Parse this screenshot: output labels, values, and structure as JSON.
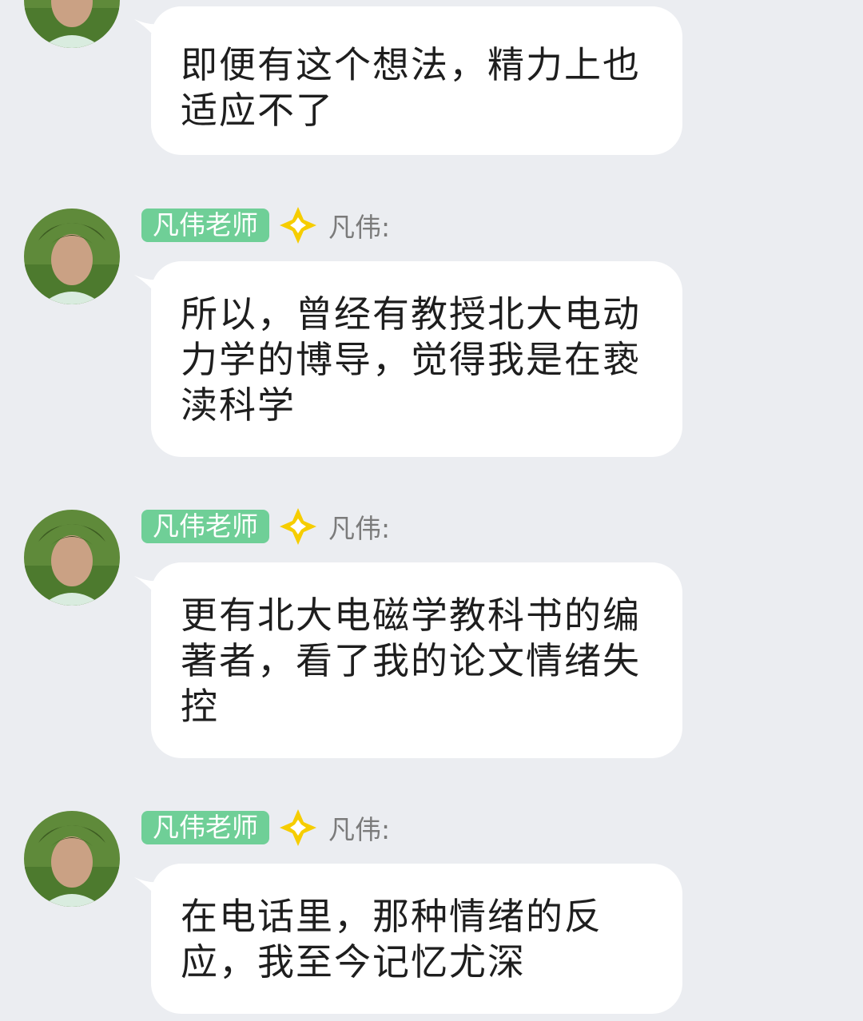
{
  "colors": {
    "background": "#ebedf1",
    "bubble": "#ffffff",
    "badge": "#6fcf97",
    "diamond": "#f6cd00",
    "text": "#1e1e1e",
    "sender": "#7b7b7b"
  },
  "messages": [
    {
      "avatar": "avatar-photo",
      "text": "即便有这个想法，精力上也适应不了"
    },
    {
      "avatar": "avatar-photo",
      "badge": "凡伟老师",
      "icon": "diamond-icon",
      "sender": "凡伟:",
      "text": "所以，曾经有教授北大电动力学的博导，觉得我是在亵渎科学"
    },
    {
      "avatar": "avatar-photo",
      "badge": "凡伟老师",
      "icon": "diamond-icon",
      "sender": "凡伟:",
      "text": "更有北大电磁学教科书的编著者，看了我的论文情绪失控"
    },
    {
      "avatar": "avatar-photo",
      "badge": "凡伟老师",
      "icon": "diamond-icon",
      "sender": "凡伟:",
      "text": "在电话里，那种情绪的反应，我至今记忆尤深"
    }
  ]
}
